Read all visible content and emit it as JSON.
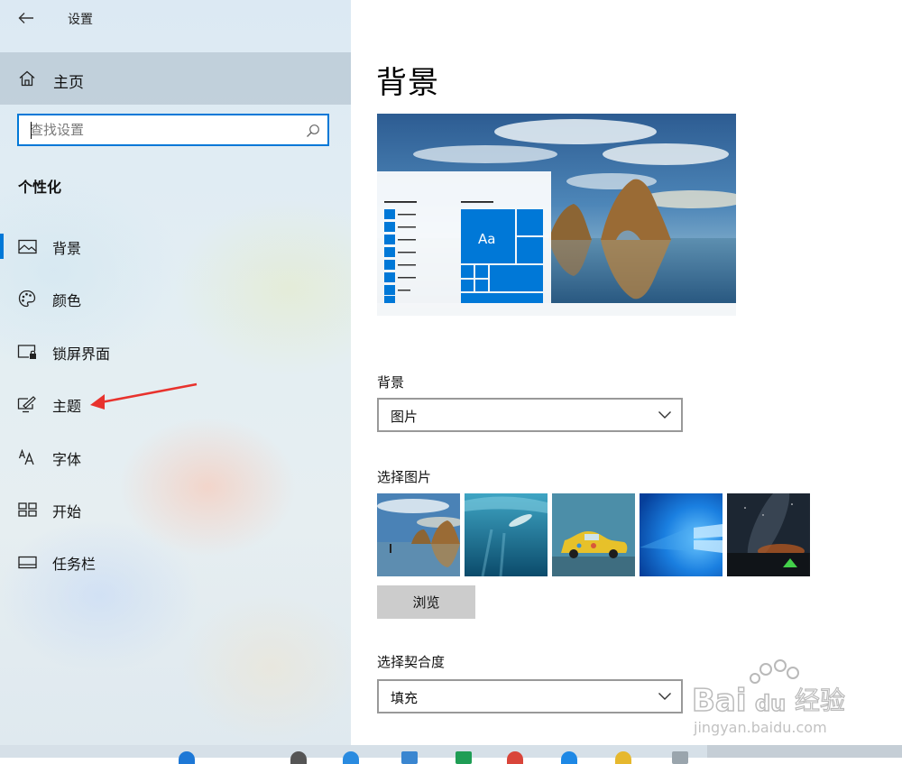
{
  "window": {
    "title": "设置"
  },
  "sidebar": {
    "home_label": "主页",
    "search_placeholder": "查找设置",
    "section_title": "个性化",
    "items": [
      {
        "label": "背景",
        "icon": "picture-icon",
        "active": true
      },
      {
        "label": "颜色",
        "icon": "palette-icon",
        "active": false
      },
      {
        "label": "锁屏界面",
        "icon": "lock-screen-icon",
        "active": false
      },
      {
        "label": "主题",
        "icon": "theme-brush-icon",
        "active": false
      },
      {
        "label": "字体",
        "icon": "font-icon",
        "active": false
      },
      {
        "label": "开始",
        "icon": "start-grid-icon",
        "active": false
      },
      {
        "label": "任务栏",
        "icon": "taskbar-icon",
        "active": false
      }
    ]
  },
  "main": {
    "page_title": "背景",
    "preview": {
      "tile_text": "Aa"
    },
    "background": {
      "label": "背景",
      "value": "图片"
    },
    "choose_picture": {
      "label": "选择图片",
      "browse_label": "浏览"
    },
    "fit": {
      "label": "选择契合度",
      "value": "填充"
    }
  },
  "watermark": {
    "brand": "Bai",
    "brand_du": "du",
    "cn": "经验",
    "url": "jingyan.baidu.com"
  },
  "colors": {
    "accent": "#0078d7",
    "annotation_arrow": "#e8322d"
  }
}
